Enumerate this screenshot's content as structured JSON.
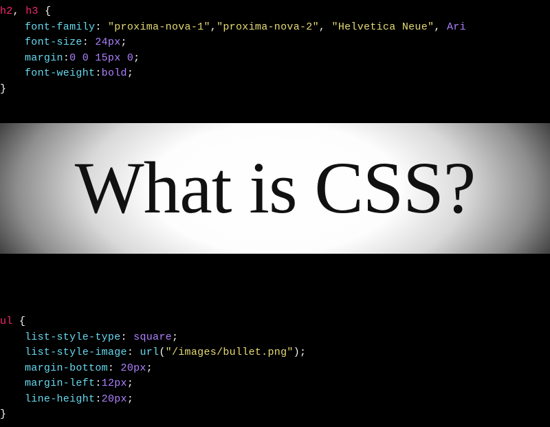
{
  "code_top": {
    "selector_line": [
      {
        "t": "h2",
        "c": "sel"
      },
      {
        "t": ", ",
        "c": "comma"
      },
      {
        "t": "h3",
        "c": "sel"
      },
      {
        "t": " ",
        "c": "colon"
      },
      {
        "t": "{",
        "c": "brace"
      }
    ],
    "lines": [
      [
        {
          "t": "font-family",
          "c": "prop"
        },
        {
          "t": ": ",
          "c": "colon"
        },
        {
          "t": "\"proxima-nova-1\"",
          "c": "str"
        },
        {
          "t": ",",
          "c": "comma"
        },
        {
          "t": "\"proxima-nova-2\"",
          "c": "str"
        },
        {
          "t": ", ",
          "c": "comma"
        },
        {
          "t": "\"Helvetica Neue\"",
          "c": "str"
        },
        {
          "t": ", ",
          "c": "comma"
        },
        {
          "t": "Ar",
          "c": "val"
        },
        {
          "t": "i",
          "c": "val"
        }
      ],
      [
        {
          "t": "font-size",
          "c": "prop"
        },
        {
          "t": ": ",
          "c": "colon"
        },
        {
          "t": "24px",
          "c": "val"
        },
        {
          "t": ";",
          "c": "colon"
        }
      ],
      [
        {
          "t": "margin",
          "c": "prop"
        },
        {
          "t": ":",
          "c": "colon"
        },
        {
          "t": "0 0 15px 0",
          "c": "val"
        },
        {
          "t": ";",
          "c": "colon"
        }
      ],
      [
        {
          "t": "font-weight",
          "c": "prop"
        },
        {
          "t": ":",
          "c": "colon"
        },
        {
          "t": "bold",
          "c": "val"
        },
        {
          "t": ";",
          "c": "colon"
        }
      ]
    ],
    "close": [
      {
        "t": "}",
        "c": "brace"
      }
    ]
  },
  "banner": {
    "title": "What is CSS?"
  },
  "code_bottom": {
    "selector_line": [
      {
        "t": "ul",
        "c": "sel"
      },
      {
        "t": " ",
        "c": "colon"
      },
      {
        "t": "{",
        "c": "brace"
      }
    ],
    "lines": [
      [
        {
          "t": "list-style-type",
          "c": "prop"
        },
        {
          "t": ": ",
          "c": "colon"
        },
        {
          "t": "square",
          "c": "val"
        },
        {
          "t": ";",
          "c": "colon"
        }
      ],
      [
        {
          "t": "list-style-image",
          "c": "prop"
        },
        {
          "t": ": ",
          "c": "colon"
        },
        {
          "t": "url",
          "c": "func"
        },
        {
          "t": "(",
          "c": "colon"
        },
        {
          "t": "\"/images/bullet.png\"",
          "c": "str"
        },
        {
          "t": ")",
          "c": "colon"
        },
        {
          "t": ";",
          "c": "colon"
        }
      ],
      [
        {
          "t": "margin-bottom",
          "c": "prop"
        },
        {
          "t": ": ",
          "c": "colon"
        },
        {
          "t": "20px",
          "c": "val"
        },
        {
          "t": ";",
          "c": "colon"
        }
      ],
      [
        {
          "t": "margin-left",
          "c": "prop"
        },
        {
          "t": ":",
          "c": "colon"
        },
        {
          "t": "12px",
          "c": "val"
        },
        {
          "t": ";",
          "c": "colon"
        }
      ],
      [
        {
          "t": "line-height",
          "c": "prop"
        },
        {
          "t": ":",
          "c": "colon"
        },
        {
          "t": "20px",
          "c": "val"
        },
        {
          "t": ";",
          "c": "colon"
        }
      ]
    ],
    "close": [
      {
        "t": "}",
        "c": "brace"
      }
    ]
  }
}
